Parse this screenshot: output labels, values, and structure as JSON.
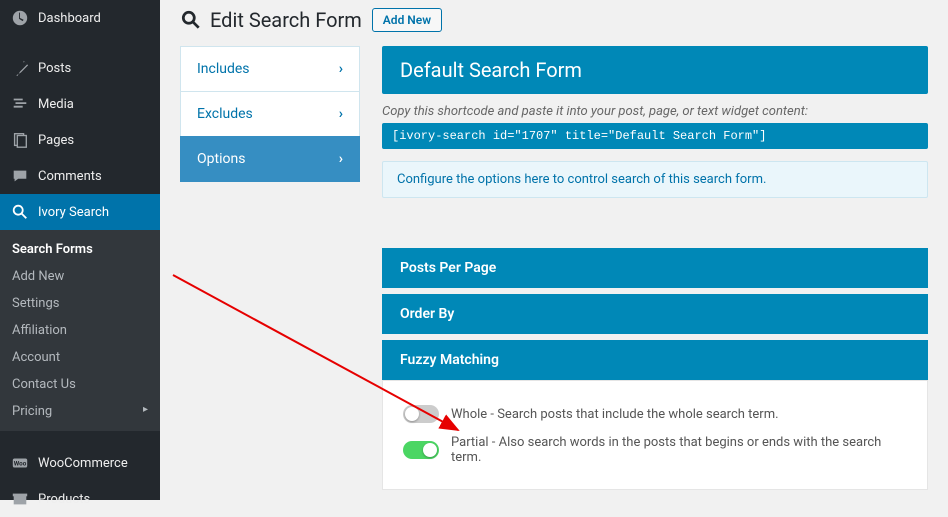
{
  "sidebar": {
    "items": [
      {
        "label": "Dashboard",
        "icon": "dashboard"
      },
      {
        "label": "Posts",
        "icon": "pin"
      },
      {
        "label": "Media",
        "icon": "media"
      },
      {
        "label": "Pages",
        "icon": "pages"
      },
      {
        "label": "Comments",
        "icon": "comment"
      },
      {
        "label": "Ivory Search",
        "icon": "search",
        "active": true
      },
      {
        "label": "WooCommerce",
        "icon": "woo"
      },
      {
        "label": "Products",
        "icon": "box"
      }
    ],
    "sub": [
      {
        "label": "Search Forms",
        "active": true
      },
      {
        "label": "Add New"
      },
      {
        "label": "Settings"
      },
      {
        "label": "Affiliation"
      },
      {
        "label": "Account"
      },
      {
        "label": "Contact Us"
      },
      {
        "label": "Pricing",
        "chev": true
      }
    ]
  },
  "header": {
    "title": "Edit Search Form",
    "add_new": "Add New"
  },
  "tabs": [
    {
      "label": "Includes"
    },
    {
      "label": "Excludes"
    },
    {
      "label": "Options",
      "active": true
    }
  ],
  "panel": {
    "title": "Default Search Form",
    "desc": "Copy this shortcode and paste it into your post, page, or text widget content:",
    "shortcode": "[ivory-search id=\"1707\" title=\"Default Search Form\"]",
    "info": "Configure the options here to control search of this search form."
  },
  "blocks": {
    "posts_per_page": "Posts Per Page",
    "order_by": "Order By",
    "fuzzy": "Fuzzy Matching"
  },
  "fuzzy": {
    "whole": "Whole - Search posts that include the whole search term.",
    "partial": "Partial - Also search words in the posts that begins or ends with the search term."
  }
}
